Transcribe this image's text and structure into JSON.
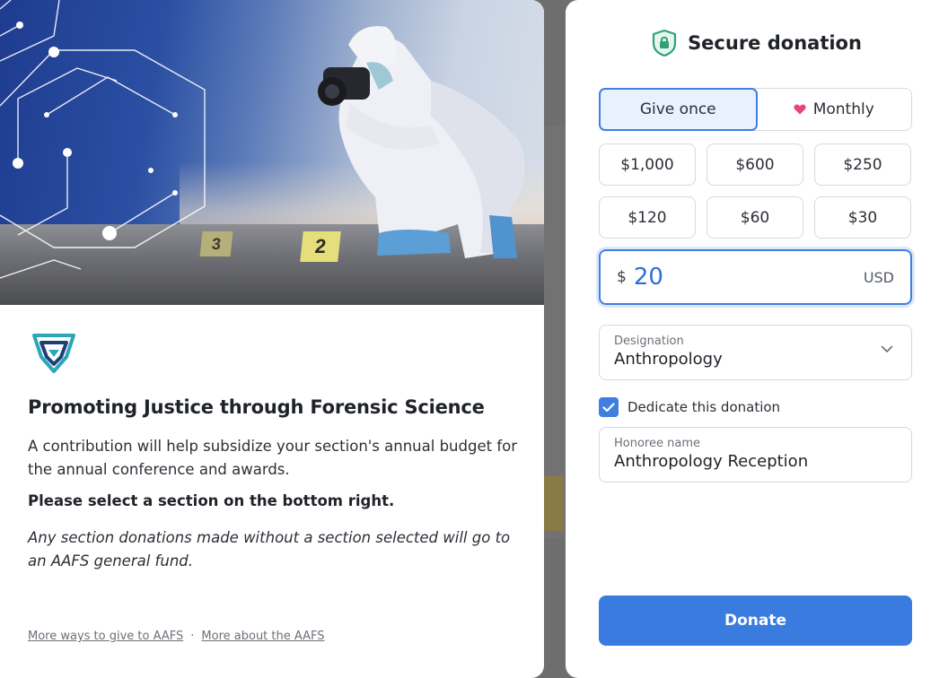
{
  "hero": {
    "evidence_markers": [
      "3",
      "2"
    ]
  },
  "left": {
    "title": "Promoting Justice through Forensic Science",
    "description": "A contribution will help subsidize your section's annual budget for the annual conference and awards.",
    "bold_note": "Please select a section on the bottom right.",
    "italic_note": "Any section donations made without a section selected will go to an AAFS general fund.",
    "footer": {
      "link1": "More ways to give to AAFS",
      "separator": "·",
      "link2": "More about the AAFS"
    }
  },
  "right": {
    "header_title": "Secure donation",
    "frequency": {
      "once_label": "Give once",
      "monthly_label": "Monthly",
      "selected": "once"
    },
    "amounts": [
      "$1,000",
      "$600",
      "$250",
      "$120",
      "$60",
      "$30"
    ],
    "amount_input": {
      "currency_symbol": "$",
      "value": "20",
      "currency_code": "USD"
    },
    "designation": {
      "label": "Designation",
      "value": "Anthropology"
    },
    "dedicate": {
      "label": "Dedicate this donation",
      "checked": true
    },
    "honoree": {
      "label": "Honoree name",
      "value": "Anthropology Reception"
    },
    "donate_label": "Donate"
  },
  "colors": {
    "accent": "#3a7be0",
    "shield": "#2fa27a",
    "heart": "#e8457a",
    "logo_teal": "#2aa7b8",
    "logo_navy": "#1f3f7a"
  },
  "icons": {
    "shield": "shield-lock-icon",
    "heart": "heart-icon",
    "chevron": "chevron-down-icon",
    "check": "check-icon"
  }
}
